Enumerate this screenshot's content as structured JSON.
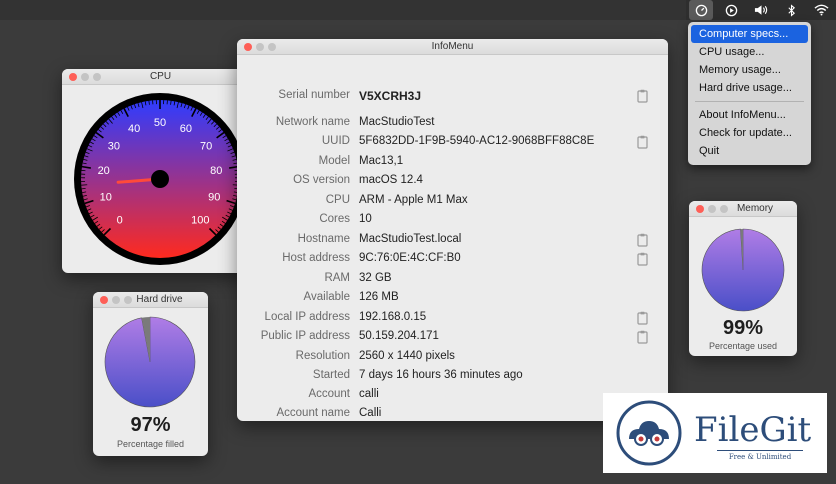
{
  "menubar": {
    "icons": [
      "gauge-icon",
      "play-circle-icon",
      "volume-icon",
      "bluetooth-icon",
      "wifi-icon"
    ]
  },
  "dropdown": {
    "group1": [
      "Computer specs...",
      "CPU usage...",
      "Memory usage...",
      "Hard drive usage..."
    ],
    "group2": [
      "About InfoMenu...",
      "Check for update...",
      "Quit"
    ]
  },
  "info": {
    "title": "InfoMenu",
    "rows": [
      {
        "label": "Serial number",
        "value": "V5XCRH3J"
      },
      {
        "label": "Network name",
        "value": "MacStudioTest"
      },
      {
        "label": "UUID",
        "value": "5F6832DD-1F9B-5940-AC12-9068BFF88C8E"
      },
      {
        "label": "Model",
        "value": "Mac13,1"
      },
      {
        "label": "OS version",
        "value": "macOS 12.4"
      },
      {
        "label": "CPU",
        "value": "ARM - Apple M1 Max"
      },
      {
        "label": "Cores",
        "value": "10"
      },
      {
        "label": "Hostname",
        "value": "MacStudioTest.local"
      },
      {
        "label": "Host address",
        "value": "9C:76:0E:4C:CF:B0"
      },
      {
        "label": "RAM",
        "value": "32 GB"
      },
      {
        "label": "Available",
        "value": "126 MB"
      },
      {
        "label": "Local IP address",
        "value": "192.168.0.15"
      },
      {
        "label": "Public IP address",
        "value": "50.159.204.171"
      },
      {
        "label": "Resolution",
        "value": "2560 x 1440 pixels"
      },
      {
        "label": "Started",
        "value": "7 days 16 hours 36 minutes ago"
      },
      {
        "label": "Account",
        "value": "calli"
      },
      {
        "label": "Account name",
        "value": "Calli"
      }
    ]
  },
  "cpu": {
    "title": "CPU",
    "ticks": [
      "0",
      "10",
      "20",
      "30",
      "40",
      "50",
      "60",
      "70",
      "80",
      "90",
      "100"
    ],
    "needle_value": 15
  },
  "harddrive": {
    "title": "Hard drive",
    "percent_text": "97%",
    "caption": "Percentage filled",
    "fraction": 0.97
  },
  "memory": {
    "title": "Memory",
    "percent_text": "99%",
    "caption": "Percentage used",
    "fraction": 0.99
  },
  "logo": {
    "name": "FileGit",
    "tagline": "Free & Unlimited"
  },
  "colors": {
    "highlight": "#1b63e0",
    "gauge_top": "#2f3cff",
    "gauge_bottom": "#ff2a1e",
    "pie_fill": "#8a6bd8"
  }
}
